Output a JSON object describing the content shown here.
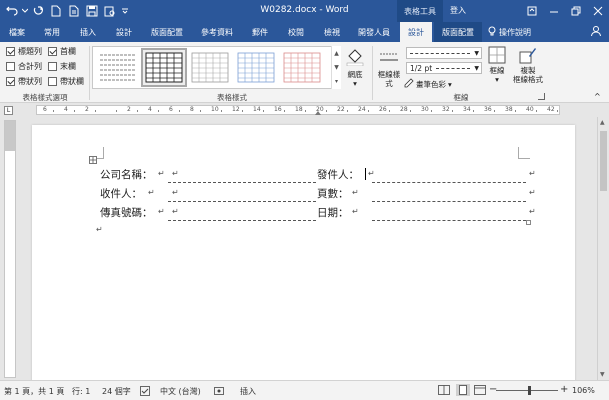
{
  "titlebar": {
    "doc_title": "W0282.docx - Word",
    "context_title": "表格工具",
    "signin": "登入"
  },
  "tabs": [
    {
      "label": "檔案"
    },
    {
      "label": "常用"
    },
    {
      "label": "插入"
    },
    {
      "label": "設計"
    },
    {
      "label": "版面配置"
    },
    {
      "label": "參考資料"
    },
    {
      "label": "郵件"
    },
    {
      "label": "校閱"
    },
    {
      "label": "檢視"
    },
    {
      "label": "開發人員"
    },
    {
      "label": "設計"
    },
    {
      "label": "版面配置"
    }
  ],
  "tellme": "操作說明",
  "ribbon": {
    "style_options": {
      "label": "表格樣式選項",
      "checks": [
        {
          "label": "標題列",
          "checked": true
        },
        {
          "label": "首欄",
          "checked": true
        },
        {
          "label": "合計列",
          "checked": false
        },
        {
          "label": "末欄",
          "checked": false
        },
        {
          "label": "帶狀列",
          "checked": true
        },
        {
          "label": "帶狀欄",
          "checked": false
        }
      ]
    },
    "table_styles": {
      "label": "表格樣式",
      "shading": "網底"
    },
    "borders": {
      "label": "框線",
      "border_styles": "框線樣式",
      "pen_weight": "1/2 pt",
      "pen_color": "畫筆色彩",
      "borders_btn": "框線",
      "painter_line1": "複製",
      "painter_line2": "框線格式"
    }
  },
  "ruler": {
    "numbers": [
      "6",
      "4",
      "2",
      "",
      "2",
      "4",
      "6",
      "8",
      "10",
      "12",
      "14",
      "16",
      "18",
      "20",
      "22",
      "24",
      "26",
      "28",
      "30",
      "32",
      "34",
      "36",
      "38",
      "40",
      "42"
    ]
  },
  "document": {
    "rows": [
      {
        "left_label": "公司名稱：",
        "right_label": "發件人："
      },
      {
        "left_label": "收件人：",
        "right_label": "頁數："
      },
      {
        "left_label": "傳真號碼：",
        "right_label": "日期："
      }
    ],
    "cell_mark": "↵"
  },
  "status": {
    "page": "第 1 頁，共 1 頁",
    "line": "行: 1",
    "words": "24 個字",
    "language": "中文 (台灣)",
    "mode": "插入",
    "zoom": "106%"
  },
  "colors": {
    "accent": "#2b579a"
  }
}
